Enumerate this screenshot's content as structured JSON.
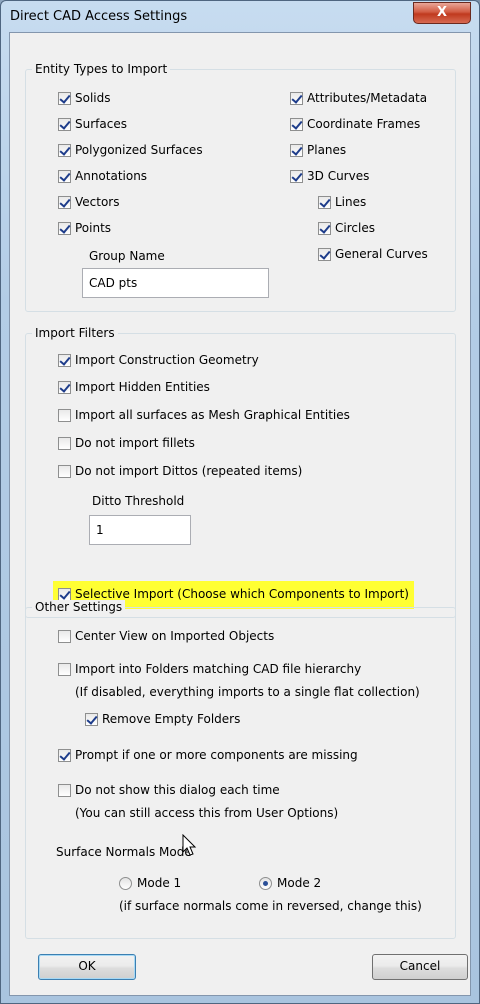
{
  "window": {
    "title": "Direct CAD Access Settings",
    "close_label": "X"
  },
  "entity_types": {
    "legend": "Entity Types to Import",
    "left_items": [
      {
        "label": "Solids",
        "checked": true
      },
      {
        "label": "Surfaces",
        "checked": true
      },
      {
        "label": "Polygonized Surfaces",
        "checked": true
      },
      {
        "label": "Annotations",
        "checked": true
      },
      {
        "label": "Vectors",
        "checked": true
      },
      {
        "label": "Points",
        "checked": true
      }
    ],
    "right_items": [
      {
        "label": "Attributes/Metadata",
        "checked": true
      },
      {
        "label": "Coordinate Frames",
        "checked": true
      },
      {
        "label": "Planes",
        "checked": true
      },
      {
        "label": "3D Curves",
        "checked": true
      }
    ],
    "curve_subitems": [
      {
        "label": "Lines",
        "checked": true
      },
      {
        "label": "Circles",
        "checked": true
      },
      {
        "label": "General Curves",
        "checked": true
      }
    ],
    "group_name_label": "Group Name",
    "group_name_value": "CAD pts"
  },
  "import_filters": {
    "legend": "Import Filters",
    "items": [
      {
        "label": "Import Construction Geometry",
        "checked": true
      },
      {
        "label": "Import Hidden Entities",
        "checked": true
      },
      {
        "label": "Import all surfaces as Mesh Graphical Entities",
        "checked": false
      },
      {
        "label": "Do not import fillets",
        "checked": false
      },
      {
        "label": "Do not import Dittos (repeated items)",
        "checked": false
      }
    ],
    "ditto_threshold_label": "Ditto Threshold",
    "ditto_threshold_value": "1",
    "selective_import": {
      "label": "Selective Import (Choose which Components to Import)",
      "checked": true
    },
    "highlight_color": "#ffff33"
  },
  "other_settings": {
    "legend": "Other Settings",
    "center_view": {
      "label": "Center View on Imported Objects",
      "checked": false
    },
    "import_folders": {
      "label": "Import into Folders matching CAD file hierarchy",
      "checked": false
    },
    "import_folders_note": "(If disabled, everything imports to a single flat collection)",
    "remove_empty": {
      "label": "Remove Empty Folders",
      "checked": true
    },
    "prompt_missing": {
      "label": "Prompt if one or more components are missing",
      "checked": true
    },
    "dont_show": {
      "label": "Do not show this dialog each time",
      "checked": false
    },
    "dont_show_note": "(You can still access this from User Options)",
    "normals_label": "Surface Normals Mode",
    "mode1": {
      "label": "Mode 1",
      "selected": false
    },
    "mode2": {
      "label": "Mode 2",
      "selected": true
    },
    "normals_note": "(if surface normals come in reversed, change this)"
  },
  "buttons": {
    "ok": "OK",
    "cancel": "Cancel"
  }
}
